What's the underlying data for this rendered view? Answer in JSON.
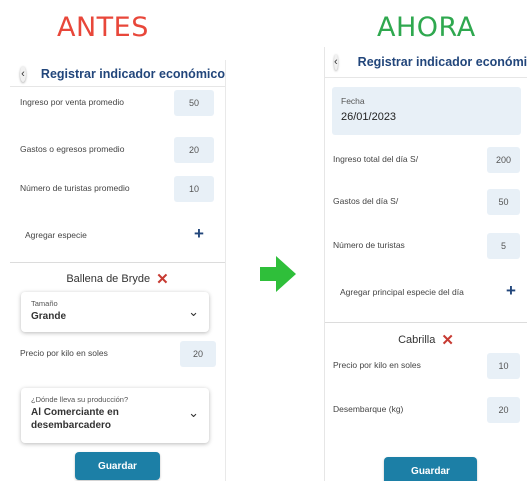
{
  "headings": {
    "before": "ANTES",
    "after": "AHORA"
  },
  "before": {
    "title": "Registrar indicador económico",
    "rows": [
      {
        "label": "Ingreso por venta promedio",
        "value": "50"
      },
      {
        "label": "Gastos o egresos promedio",
        "value": "20"
      },
      {
        "label": "Número de turistas promedio",
        "value": "10"
      }
    ],
    "add_species_label": "Agregar especie",
    "species_name": "Ballena de Bryde",
    "size_select": {
      "caption": "Tamaño",
      "value": "Grande"
    },
    "price_row": {
      "label": "Precio por kilo en soles",
      "value": "20"
    },
    "destination_select": {
      "caption": "¿Dónde lleva su producción?",
      "value_line1": "Al Comerciante en",
      "value_line2": "desembarcadero"
    },
    "save_label": "Guardar"
  },
  "after": {
    "title": "Registrar indicador económico",
    "date_field": {
      "caption": "Fecha",
      "value": "26/01/2023"
    },
    "rows": [
      {
        "label": "Ingreso total del día S/",
        "value": "200"
      },
      {
        "label": "Gastos del día S/",
        "value": "50"
      },
      {
        "label": "Número de turistas",
        "value": "5"
      }
    ],
    "add_species_label": "Agregar principal especie del día",
    "species_name": "Cabrilla",
    "price_row": {
      "label": "Precio por kilo en soles",
      "value": "10"
    },
    "landing_row": {
      "label": "Desembarque (kg)",
      "value": "20"
    },
    "save_label": "Guardar"
  },
  "icons": {
    "back": "chevron-left-icon",
    "add": "plus-icon",
    "remove": "close-icon",
    "dropdown": "chevron-down-icon",
    "transition": "arrow-right-icon"
  },
  "colors": {
    "before_heading": "#e8473a",
    "after_heading": "#2fa84f",
    "title": "#22467b",
    "value_box": "#e8f0f7",
    "button": "#1c7fa6",
    "remove": "#c73a32",
    "arrow": "#2fbf3a"
  }
}
